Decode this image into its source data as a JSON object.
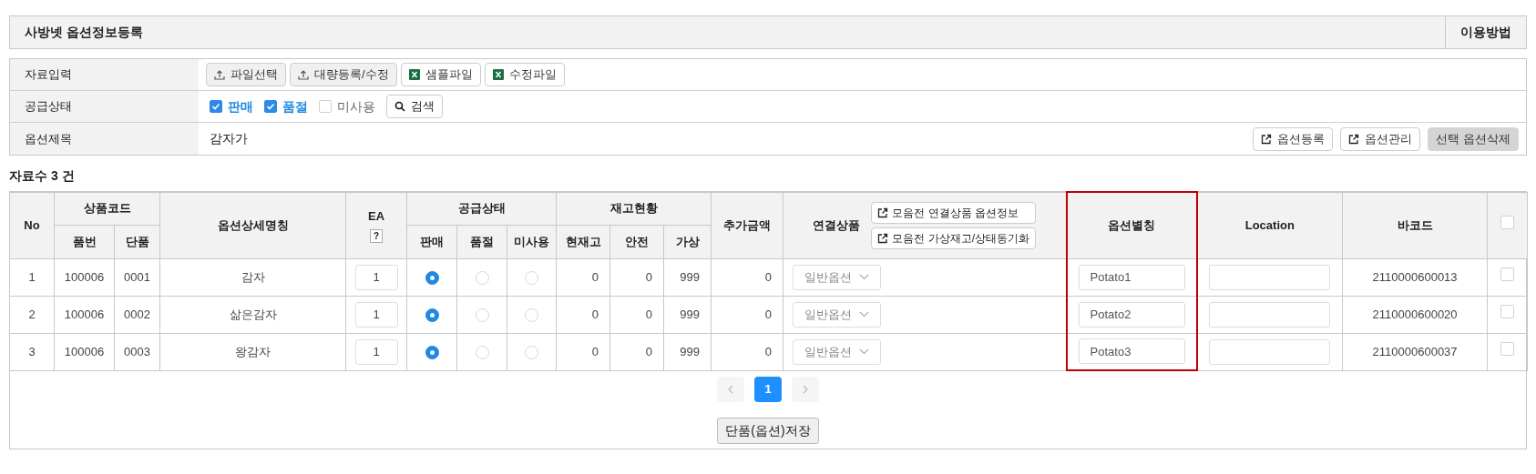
{
  "header": {
    "title": "사방넷 옵션정보등록",
    "help_button": "이용방법"
  },
  "form": {
    "data_input": {
      "label": "자료입력",
      "buttons": [
        {
          "kind": "upload",
          "label": "파일선택"
        },
        {
          "kind": "upload",
          "label": "대량등록/수정"
        },
        {
          "kind": "excel",
          "label": "샘플파일"
        },
        {
          "kind": "excel",
          "label": "수정파일"
        }
      ]
    },
    "supply_status": {
      "label": "공급상태",
      "options": [
        {
          "label": "판매",
          "checked": true
        },
        {
          "label": "품절",
          "checked": true
        },
        {
          "label": "미사용",
          "checked": false
        }
      ],
      "search_button": "검색"
    },
    "option_title": {
      "label": "옵션제목",
      "value": "감자가",
      "buttons": [
        {
          "kind": "external",
          "label": "옵션등록"
        },
        {
          "kind": "external",
          "label": "옵션관리"
        },
        {
          "kind": "gray",
          "label": "선택 옵션삭제"
        }
      ]
    }
  },
  "record_count": "자료수 3 건",
  "table": {
    "header_groups": {
      "no": "No",
      "product_code": "상품코드",
      "item_no": "품번",
      "unit": "단품",
      "option_name": "옵션상세명칭",
      "ea": "EA",
      "ea_help": "?",
      "supply": "공급상태",
      "supply_cols": [
        "판매",
        "품절",
        "미사용"
      ],
      "stock": "재고현황",
      "stock_cols": [
        "현재고",
        "안전",
        "가상"
      ],
      "extra": "추가금액",
      "linked": "연결상품",
      "linked_buttons": [
        "모음전 연결상품 옵션정보",
        "모음전 가상재고/상태동기화"
      ],
      "alias": "옵션별칭",
      "location": "Location",
      "barcode": "바코드"
    },
    "select_all": {
      "checked": false
    },
    "rows": [
      {
        "no": "1",
        "item_no": "100006",
        "unit": "0001",
        "option_name": "감자",
        "ea": "1",
        "supply": [
          {
            "selected": true
          },
          {
            "selected": false
          },
          {
            "selected": false
          }
        ],
        "stock": [
          "0",
          "0",
          "999"
        ],
        "extra": "0",
        "linked": "일반옵션",
        "alias": "Potato1",
        "barcode": "2110000600013",
        "checked": false
      },
      {
        "no": "2",
        "item_no": "100006",
        "unit": "0002",
        "option_name": "삶은감자",
        "ea": "1",
        "supply": [
          {
            "selected": true
          },
          {
            "selected": false
          },
          {
            "selected": false
          }
        ],
        "stock": [
          "0",
          "0",
          "999"
        ],
        "extra": "0",
        "linked": "일반옵션",
        "alias": "Potato2",
        "barcode": "2110000600020",
        "checked": false
      },
      {
        "no": "3",
        "item_no": "100006",
        "unit": "0003",
        "option_name": "왕감자",
        "ea": "1",
        "supply": [
          {
            "selected": true
          },
          {
            "selected": false
          },
          {
            "selected": false
          }
        ],
        "stock": [
          "0",
          "0",
          "999"
        ],
        "extra": "0",
        "linked": "일반옵션",
        "alias": "Potato3",
        "barcode": "2110000600037",
        "checked": false
      }
    ]
  },
  "pagination": {
    "pages": [
      {
        "label": "1",
        "selected": true
      }
    ]
  },
  "save_button": "단품(옵션)저장"
}
